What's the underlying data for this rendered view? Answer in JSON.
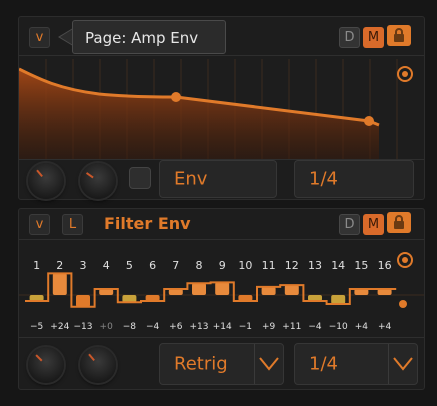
{
  "tooltip": {
    "text": "Page: Amp Env"
  },
  "amp_panel": {
    "v_label": "v",
    "d_label": "D",
    "m_label": "M",
    "field_env": "Env",
    "field_rate": "1/4"
  },
  "filter_panel": {
    "v_label": "v",
    "l_label": "L",
    "title": "Filter Env",
    "d_label": "D",
    "m_label": "M",
    "steps": [
      {
        "n": "1",
        "v": "−5"
      },
      {
        "n": "2",
        "v": "+24"
      },
      {
        "n": "3",
        "v": "−13"
      },
      {
        "n": "4",
        "v": "+0"
      },
      {
        "n": "5",
        "v": "−8"
      },
      {
        "n": "6",
        "v": "−4"
      },
      {
        "n": "7",
        "v": "+6"
      },
      {
        "n": "8",
        "v": "+13"
      },
      {
        "n": "9",
        "v": "+14"
      },
      {
        "n": "10",
        "v": "−1"
      },
      {
        "n": "11",
        "v": "+9"
      },
      {
        "n": "12",
        "v": "+11"
      },
      {
        "n": "13",
        "v": "−4"
      },
      {
        "n": "14",
        "v": "−10"
      },
      {
        "n": "15",
        "v": "+4"
      },
      {
        "n": "16",
        "v": "+4"
      }
    ],
    "field_mode": "Retrig",
    "field_rate": "1/4"
  },
  "colors": {
    "accent": "#e07a2a",
    "bg": "#161616",
    "panel": "#1d1d1d"
  }
}
